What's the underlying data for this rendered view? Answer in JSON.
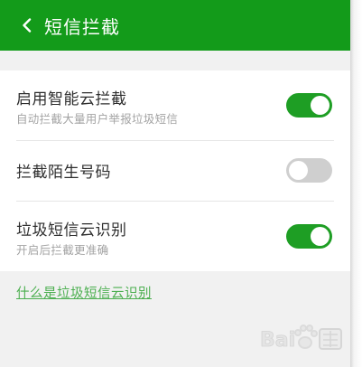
{
  "header": {
    "title": "短信拦截",
    "bg_color": "#139b1a"
  },
  "settings": [
    {
      "label": "启用智能云拦截",
      "subtitle": "自动拦截大量用户举报垃圾短信",
      "enabled": true
    },
    {
      "label": "拦截陌生号码",
      "subtitle": "",
      "enabled": false
    },
    {
      "label": "垃圾短信云识别",
      "subtitle": "开启后拦截更准确",
      "enabled": true
    }
  ],
  "link": {
    "text": "什么是垃圾短信云识别",
    "color": "#4caf50"
  },
  "colors": {
    "toggle_on": "#1e9e24",
    "toggle_off": "#cfcfcf",
    "background": "#f1f1f1"
  },
  "icons": {
    "back": "chevron-left-icon",
    "watermark": "baidu-paw-logo"
  }
}
